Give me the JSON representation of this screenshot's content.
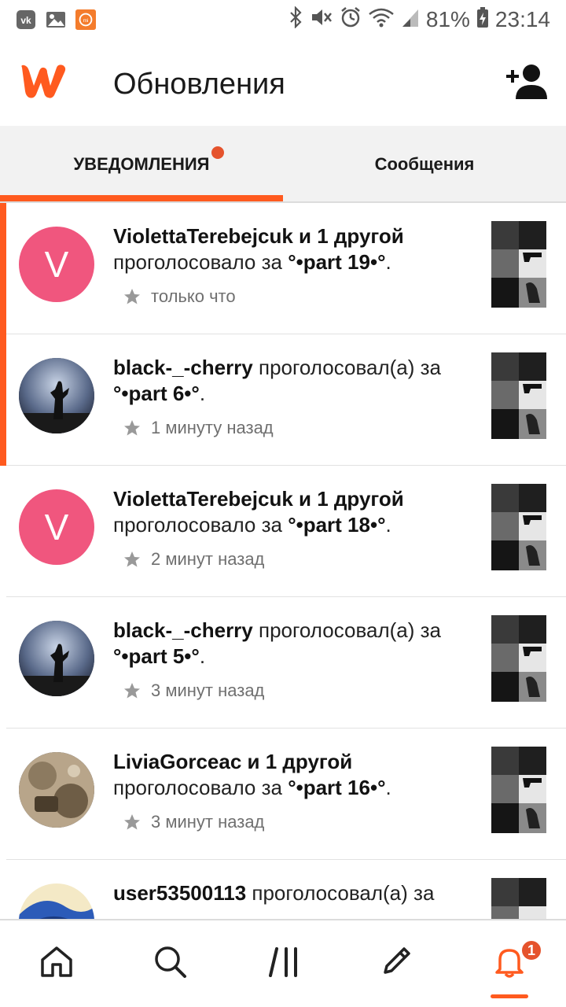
{
  "status_bar": {
    "battery": "81%",
    "time": "23:14",
    "left_icons": [
      "vk-icon",
      "gallery-icon",
      "mi-icon"
    ],
    "right_icons": [
      "bluetooth-icon",
      "mute-icon",
      "alarm-icon",
      "wifi-icon",
      "signal-icon",
      "battery-icon"
    ]
  },
  "header": {
    "title": "Обновления",
    "logo_icon": "wattpad-logo",
    "action_icon": "add-user-icon"
  },
  "tabs": [
    {
      "label": "УВЕДОМЛЕНИЯ",
      "active": true,
      "has_dot": true
    },
    {
      "label": "Сообщения",
      "active": false,
      "has_dot": false
    }
  ],
  "notifications": [
    {
      "avatar_type": "letter",
      "avatar_letter": "V",
      "actor": "ViolettaTerebejcuk и 1 другой",
      "action": " проголосовало за ",
      "story": "°•part 19•°",
      "suffix": ".",
      "time": "только что",
      "unread": true
    },
    {
      "avatar_type": "photo",
      "avatar_letter": "",
      "actor": "black-_-cherry",
      "action": " проголосовал(а) за ",
      "story": "°•part 6•°",
      "suffix": ".",
      "time": "1 минуту назад",
      "unread": true
    },
    {
      "avatar_type": "letter",
      "avatar_letter": "V",
      "actor": "ViolettaTerebejcuk и 1 другой",
      "action": " проголосовало за ",
      "story": "°•part 18•°",
      "suffix": ".",
      "time": "2 минут назад",
      "unread": false
    },
    {
      "avatar_type": "photo",
      "avatar_letter": "",
      "actor": "black-_-cherry",
      "action": " проголосовал(а) за ",
      "story": "°•part 5•°",
      "suffix": ".",
      "time": "3 минут назад",
      "unread": false
    },
    {
      "avatar_type": "photo",
      "avatar_letter": "",
      "actor": "LiviaGorceac и 1 другой",
      "action": " проголосовало за ",
      "story": "°•part 16•°",
      "suffix": ".",
      "time": "3 минут назад",
      "unread": false
    },
    {
      "avatar_type": "photo",
      "avatar_letter": "",
      "actor": "user53500113",
      "action": " проголосовал(а) за ",
      "story": "",
      "suffix": "",
      "time": "",
      "unread": false
    }
  ],
  "bottom_nav": {
    "items": [
      "home-icon",
      "search-icon",
      "library-icon",
      "write-icon",
      "notifications-icon"
    ],
    "badge": "1",
    "active": "notifications-icon"
  },
  "colors": {
    "accent": "#ff5a1f",
    "badge": "#e5532d",
    "avatar_letter_bg": "#f0567e"
  }
}
